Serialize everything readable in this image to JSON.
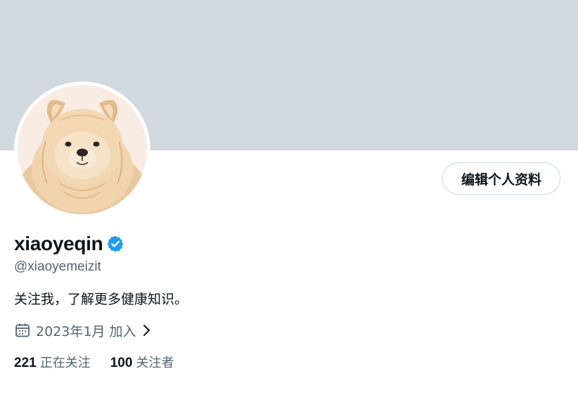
{
  "profile": {
    "display_name": "xiaoyeqin",
    "handle": "@xiaoyemeizit",
    "bio": "关注我，了解更多健康知识。",
    "joined": "2023年1月 加入",
    "verified": true,
    "edit_button_label": "编辑个人资料",
    "banner_color": "#cfd9de",
    "verified_color": "#1d9bf0",
    "avatar_icon": "chow-chow-dog-avatar"
  },
  "stats": {
    "following_count": "221",
    "following_label": "正在关注",
    "followers_count": "100",
    "followers_label": "关注者"
  }
}
